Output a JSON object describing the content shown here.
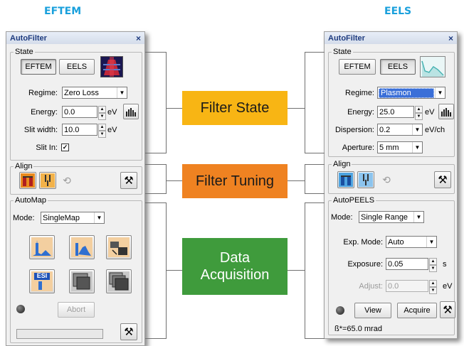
{
  "headings": {
    "eftem": "EFTEM",
    "eels": "EELS"
  },
  "callouts": {
    "filter_state": "Filter State",
    "filter_tuning": "Filter Tuning",
    "data_acquisition": [
      "Data",
      "Acquisition"
    ]
  },
  "left_panel": {
    "title": "AutoFilter",
    "close": "×",
    "state": {
      "legend": "State",
      "eftem_label": "EFTEM",
      "eels_label": "EELS",
      "regime_label": "Regime:",
      "regime_value": "Zero Loss",
      "energy_label": "Energy:",
      "energy_value": "0.0",
      "energy_unit": "eV",
      "slit_width_label": "Slit width:",
      "slit_width_value": "10.0",
      "slit_width_unit": "eV",
      "slit_in_label": "Slit In:",
      "slit_in_checked": "✓"
    },
    "align": {
      "legend": "Align"
    },
    "automap": {
      "legend": "AutoMap",
      "mode_label": "Mode:",
      "mode_value": "SingleMap",
      "esi_label": "ESI",
      "abort_label": "Abort"
    }
  },
  "right_panel": {
    "title": "AutoFilter",
    "close": "×",
    "state": {
      "legend": "State",
      "eftem_label": "EFTEM",
      "eels_label": "EELS",
      "regime_label": "Regime:",
      "regime_value": "Plasmon",
      "energy_label": "Energy:",
      "energy_value": "25.0",
      "energy_unit": "eV",
      "dispersion_label": "Dispersion:",
      "dispersion_value": "0.2",
      "dispersion_unit": "eV/ch",
      "aperture_label": "Aperture:",
      "aperture_value": "5 mm"
    },
    "align": {
      "legend": "Align"
    },
    "autopeels": {
      "legend": "AutoPEELS",
      "mode_label": "Mode:",
      "mode_value": "Single Range",
      "exp_mode_label": "Exp. Mode:",
      "exp_mode_value": "Auto",
      "exposure_label": "Exposure:",
      "exposure_value": "0.05",
      "exposure_unit": "s",
      "adjust_label": "Adjust:",
      "adjust_value": "0.0",
      "adjust_unit": "eV",
      "view_label": "View",
      "acquire_label": "Acquire",
      "beta_label": "ß*=65.0 mrad"
    }
  },
  "colors": {
    "heading": "#1aa0dc",
    "filter_state": "#f8b514",
    "filter_tuning": "#ef8221",
    "data_acquisition": "#3f9b3c"
  }
}
